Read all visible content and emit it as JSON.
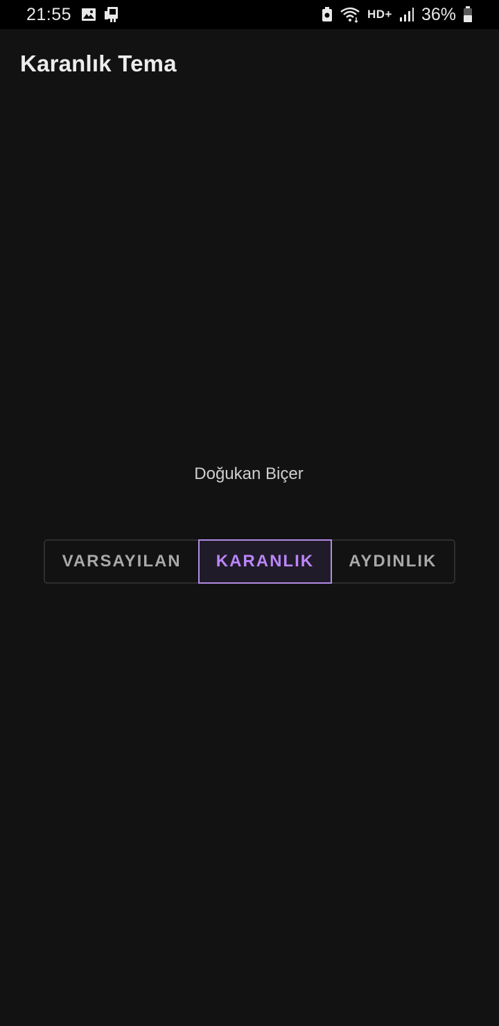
{
  "status_bar": {
    "time": "21:55",
    "network_label": "HD+",
    "battery_percent": "36%",
    "left_icons": [
      "image-icon",
      "device-icon"
    ],
    "right_icons": [
      "battery-saver-icon",
      "wifi-icon",
      "signal-icon",
      "battery-icon"
    ]
  },
  "app_bar": {
    "title": "Karanlık Tema"
  },
  "main": {
    "author": "Doğukan Biçer",
    "theme_options": [
      {
        "label": "VARSAYILAN",
        "selected": false
      },
      {
        "label": "KARANLIK",
        "selected": true
      },
      {
        "label": "AYDINLIK",
        "selected": false
      }
    ]
  },
  "colors": {
    "background": "#121212",
    "status_bar": "#000000",
    "accent": "#bb86fc",
    "text_primary": "#ececec",
    "text_secondary": "#a9a9a9"
  }
}
